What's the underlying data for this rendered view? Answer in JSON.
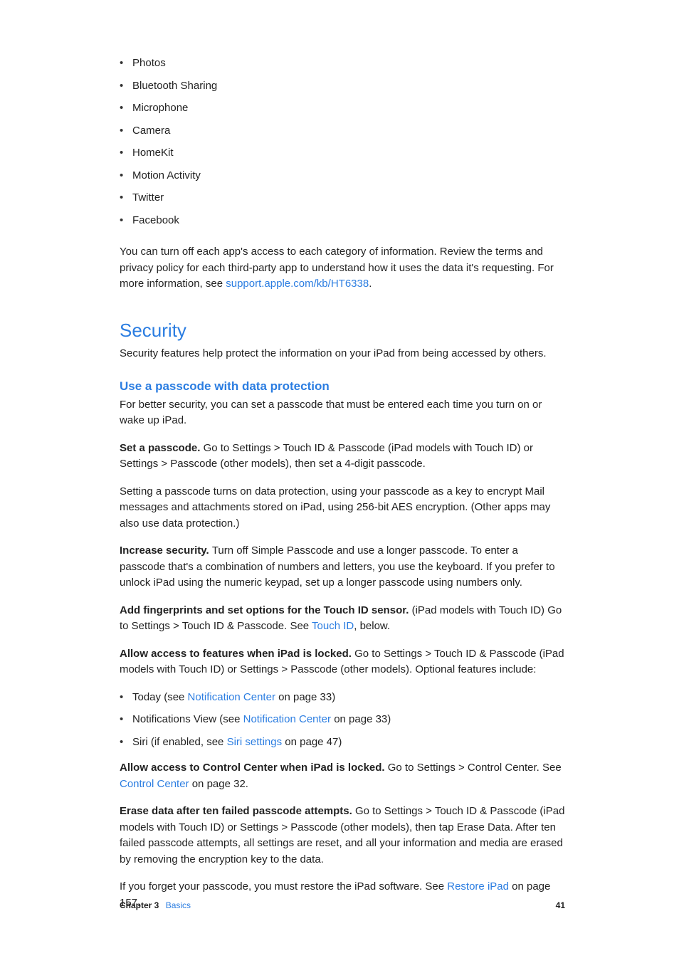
{
  "bulletList": {
    "items": [
      "Photos",
      "Bluetooth Sharing",
      "Microphone",
      "Camera",
      "HomeKit",
      "Motion Activity",
      "Twitter",
      "Facebook"
    ]
  },
  "introPara": {
    "pre": "You can turn off each app's access to each category of information. Review the terms and privacy policy for each third-party app to understand how it uses the data it's requesting. For more information, see ",
    "link": "support.apple.com/kb/HT6338",
    "post": "."
  },
  "security": {
    "heading": "Security",
    "intro": "Security features help protect the information on your iPad from being accessed by others."
  },
  "passcode": {
    "heading": "Use a passcode with data protection",
    "intro": "For better security, you can set a passcode that must be entered each time you turn on or wake up iPad.",
    "setPasscode": {
      "bold": "Set a passcode. ",
      "text": "Go to Settings > Touch ID & Passcode (iPad models with Touch ID) or Settings > Passcode (other models), then set a 4-digit passcode."
    },
    "dataProtection": "Setting a passcode turns on data protection, using your passcode as a key to encrypt Mail messages and attachments stored on iPad, using 256-bit AES encryption. (Other apps may also use data protection.)",
    "increaseSecurity": {
      "bold": "Increase security. ",
      "text": "Turn off Simple Passcode and use a longer passcode. To enter a passcode that's a combination of numbers and letters, you use the keyboard. If you prefer to unlock iPad using the numeric keypad, set up a longer passcode using numbers only."
    },
    "fingerprints": {
      "bold": "Add fingerprints and set options for the Touch ID sensor. ",
      "pre": "(iPad models with Touch ID) Go to Settings > Touch ID & Passcode. See ",
      "link": "Touch ID",
      "post": ", below."
    },
    "allowAccess": {
      "bold": "Allow access to features when iPad is locked. ",
      "text": "Go to Settings > Touch ID & Passcode (iPad models with Touch ID) or Settings > Passcode (other models). Optional features include:"
    },
    "featuresList": {
      "today": {
        "pre": "Today (see ",
        "link": "Notification Center",
        "post": " on page 33)"
      },
      "notif": {
        "pre": "Notifications View (see ",
        "link": "Notification Center",
        "post": " on page 33)"
      },
      "siri": {
        "pre": "Siri (if enabled, see ",
        "link": "Siri settings",
        "post": " on page 47)"
      }
    },
    "controlCenter": {
      "bold": "Allow access to Control Center when iPad is locked. ",
      "pre": "Go to Settings > Control Center. See ",
      "link": "Control Center",
      "post": " on page 32."
    },
    "eraseData": {
      "bold": "Erase data after ten failed passcode attempts. ",
      "text": "Go to Settings > Touch ID & Passcode (iPad models with Touch ID) or Settings > Passcode (other models), then tap Erase Data. After ten failed passcode attempts, all settings are reset, and all your information and media are erased by removing the encryption key to the data."
    },
    "forgetPasscode": {
      "pre": "If you forget your passcode, you must restore the iPad software. See ",
      "link": "Restore iPad",
      "post": " on page 157."
    }
  },
  "footer": {
    "chapter": "Chapter  3",
    "section": "Basics",
    "pageNumber": "41"
  }
}
